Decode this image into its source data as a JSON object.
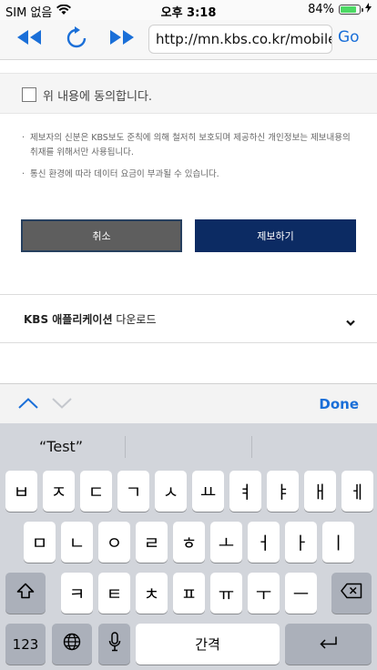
{
  "status_bar": {
    "carrier": "SIM 없음",
    "time": "오후 3:18",
    "battery": "84%",
    "battery_level": 0.84
  },
  "toolbar": {
    "url": "http://mn.kbs.co.kr/mobile/...",
    "go_label": "Go"
  },
  "agree": {
    "label": "위 내용에 동의합니다."
  },
  "notes": [
    "제보자의 신분은 KBS보도 준칙에 의해 철저히 보호되며 제공하신 개인정보는 제보내용의 취재를 위해서만 사용됩니다.",
    "통신 환경에 따라 데이터 요금이 부과될 수 있습니다."
  ],
  "buttons": {
    "cancel": "취소",
    "submit": "제보하기"
  },
  "app_download": {
    "brand": "KBS 애플리케이션",
    "suffix": " 다운로드"
  },
  "accessory": {
    "done": "Done"
  },
  "keyboard": {
    "suggestion": "“Test”",
    "row1": [
      "ㅂ",
      "ㅈ",
      "ㄷ",
      "ㄱ",
      "ㅅ",
      "ㅛ",
      "ㅕ",
      "ㅑ",
      "ㅐ",
      "ㅔ"
    ],
    "row2": [
      "ㅁ",
      "ㄴ",
      "ㅇ",
      "ㄹ",
      "ㅎ",
      "ㅗ",
      "ㅓ",
      "ㅏ",
      "ㅣ"
    ],
    "row3": [
      "ㅋ",
      "ㅌ",
      "ㅊ",
      "ㅍ",
      "ㅠ",
      "ㅜ",
      "ㅡ"
    ],
    "numbers_label": "123",
    "space_label": "간격"
  }
}
